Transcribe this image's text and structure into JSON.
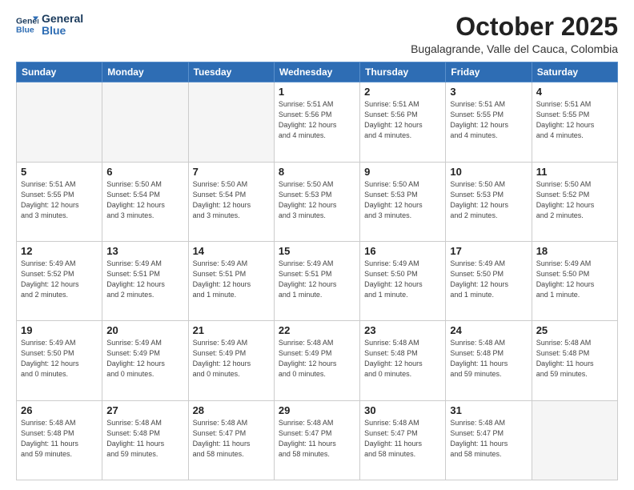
{
  "header": {
    "logo_line1": "General",
    "logo_line2": "Blue",
    "month": "October 2025",
    "location": "Bugalagrande, Valle del Cauca, Colombia"
  },
  "days_of_week": [
    "Sunday",
    "Monday",
    "Tuesday",
    "Wednesday",
    "Thursday",
    "Friday",
    "Saturday"
  ],
  "weeks": [
    [
      {
        "day": "",
        "info": ""
      },
      {
        "day": "",
        "info": ""
      },
      {
        "day": "",
        "info": ""
      },
      {
        "day": "1",
        "info": "Sunrise: 5:51 AM\nSunset: 5:56 PM\nDaylight: 12 hours\nand 4 minutes."
      },
      {
        "day": "2",
        "info": "Sunrise: 5:51 AM\nSunset: 5:56 PM\nDaylight: 12 hours\nand 4 minutes."
      },
      {
        "day": "3",
        "info": "Sunrise: 5:51 AM\nSunset: 5:55 PM\nDaylight: 12 hours\nand 4 minutes."
      },
      {
        "day": "4",
        "info": "Sunrise: 5:51 AM\nSunset: 5:55 PM\nDaylight: 12 hours\nand 4 minutes."
      }
    ],
    [
      {
        "day": "5",
        "info": "Sunrise: 5:51 AM\nSunset: 5:55 PM\nDaylight: 12 hours\nand 3 minutes."
      },
      {
        "day": "6",
        "info": "Sunrise: 5:50 AM\nSunset: 5:54 PM\nDaylight: 12 hours\nand 3 minutes."
      },
      {
        "day": "7",
        "info": "Sunrise: 5:50 AM\nSunset: 5:54 PM\nDaylight: 12 hours\nand 3 minutes."
      },
      {
        "day": "8",
        "info": "Sunrise: 5:50 AM\nSunset: 5:53 PM\nDaylight: 12 hours\nand 3 minutes."
      },
      {
        "day": "9",
        "info": "Sunrise: 5:50 AM\nSunset: 5:53 PM\nDaylight: 12 hours\nand 3 minutes."
      },
      {
        "day": "10",
        "info": "Sunrise: 5:50 AM\nSunset: 5:53 PM\nDaylight: 12 hours\nand 2 minutes."
      },
      {
        "day": "11",
        "info": "Sunrise: 5:50 AM\nSunset: 5:52 PM\nDaylight: 12 hours\nand 2 minutes."
      }
    ],
    [
      {
        "day": "12",
        "info": "Sunrise: 5:49 AM\nSunset: 5:52 PM\nDaylight: 12 hours\nand 2 minutes."
      },
      {
        "day": "13",
        "info": "Sunrise: 5:49 AM\nSunset: 5:51 PM\nDaylight: 12 hours\nand 2 minutes."
      },
      {
        "day": "14",
        "info": "Sunrise: 5:49 AM\nSunset: 5:51 PM\nDaylight: 12 hours\nand 1 minute."
      },
      {
        "day": "15",
        "info": "Sunrise: 5:49 AM\nSunset: 5:51 PM\nDaylight: 12 hours\nand 1 minute."
      },
      {
        "day": "16",
        "info": "Sunrise: 5:49 AM\nSunset: 5:50 PM\nDaylight: 12 hours\nand 1 minute."
      },
      {
        "day": "17",
        "info": "Sunrise: 5:49 AM\nSunset: 5:50 PM\nDaylight: 12 hours\nand 1 minute."
      },
      {
        "day": "18",
        "info": "Sunrise: 5:49 AM\nSunset: 5:50 PM\nDaylight: 12 hours\nand 1 minute."
      }
    ],
    [
      {
        "day": "19",
        "info": "Sunrise: 5:49 AM\nSunset: 5:50 PM\nDaylight: 12 hours\nand 0 minutes."
      },
      {
        "day": "20",
        "info": "Sunrise: 5:49 AM\nSunset: 5:49 PM\nDaylight: 12 hours\nand 0 minutes."
      },
      {
        "day": "21",
        "info": "Sunrise: 5:49 AM\nSunset: 5:49 PM\nDaylight: 12 hours\nand 0 minutes."
      },
      {
        "day": "22",
        "info": "Sunrise: 5:48 AM\nSunset: 5:49 PM\nDaylight: 12 hours\nand 0 minutes."
      },
      {
        "day": "23",
        "info": "Sunrise: 5:48 AM\nSunset: 5:48 PM\nDaylight: 12 hours\nand 0 minutes."
      },
      {
        "day": "24",
        "info": "Sunrise: 5:48 AM\nSunset: 5:48 PM\nDaylight: 11 hours\nand 59 minutes."
      },
      {
        "day": "25",
        "info": "Sunrise: 5:48 AM\nSunset: 5:48 PM\nDaylight: 11 hours\nand 59 minutes."
      }
    ],
    [
      {
        "day": "26",
        "info": "Sunrise: 5:48 AM\nSunset: 5:48 PM\nDaylight: 11 hours\nand 59 minutes."
      },
      {
        "day": "27",
        "info": "Sunrise: 5:48 AM\nSunset: 5:48 PM\nDaylight: 11 hours\nand 59 minutes."
      },
      {
        "day": "28",
        "info": "Sunrise: 5:48 AM\nSunset: 5:47 PM\nDaylight: 11 hours\nand 58 minutes."
      },
      {
        "day": "29",
        "info": "Sunrise: 5:48 AM\nSunset: 5:47 PM\nDaylight: 11 hours\nand 58 minutes."
      },
      {
        "day": "30",
        "info": "Sunrise: 5:48 AM\nSunset: 5:47 PM\nDaylight: 11 hours\nand 58 minutes."
      },
      {
        "day": "31",
        "info": "Sunrise: 5:48 AM\nSunset: 5:47 PM\nDaylight: 11 hours\nand 58 minutes."
      },
      {
        "day": "",
        "info": ""
      }
    ]
  ]
}
